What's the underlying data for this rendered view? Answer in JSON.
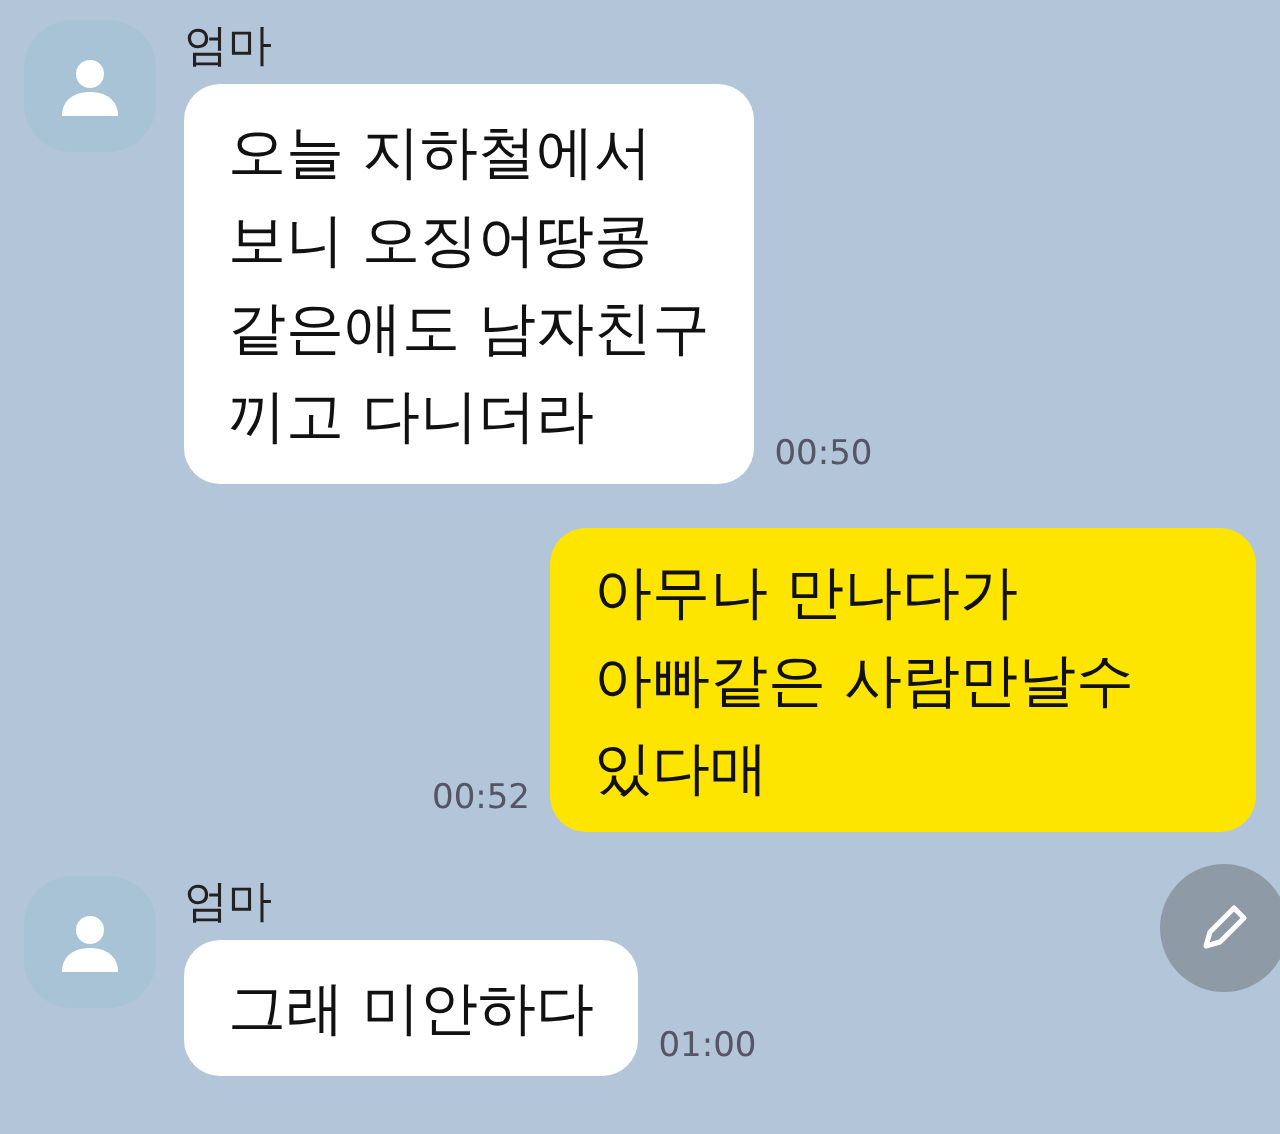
{
  "messages": [
    {
      "kind": "received",
      "sender": "엄마",
      "text": "오늘 지하철에서\n보니 오징어땅콩\n같은애도 남자친구\n끼고 다니더라",
      "time": "00:50"
    },
    {
      "kind": "sent",
      "text": "아무나 만나다가\n아빠같은 사람만날수\n있다매",
      "time": "00:52"
    },
    {
      "kind": "received",
      "sender": "엄마",
      "text": "그래 미안하다",
      "time": "01:00"
    }
  ]
}
